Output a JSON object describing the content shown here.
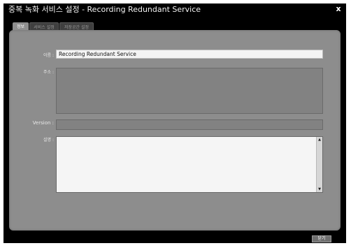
{
  "window": {
    "title": "중복 녹화 서비스 설정 - Recording Redundant Service",
    "close_glyph": "x"
  },
  "tabs": [
    {
      "label": "정보",
      "active": true
    },
    {
      "label": "서비스 설정",
      "active": false
    },
    {
      "label": "저장공간 설정",
      "active": false
    }
  ],
  "form": {
    "name_label": "이름 :",
    "name_value": "Recording Redundant Service",
    "address_label": "주소 :",
    "version_label": "Version :",
    "description_label": "설명 :"
  },
  "footer": {
    "close_label": "닫기"
  },
  "icons": {
    "close": "close-icon",
    "scroll_up": "scroll-up-arrow-icon",
    "scroll_down": "scroll-down-arrow-icon"
  }
}
